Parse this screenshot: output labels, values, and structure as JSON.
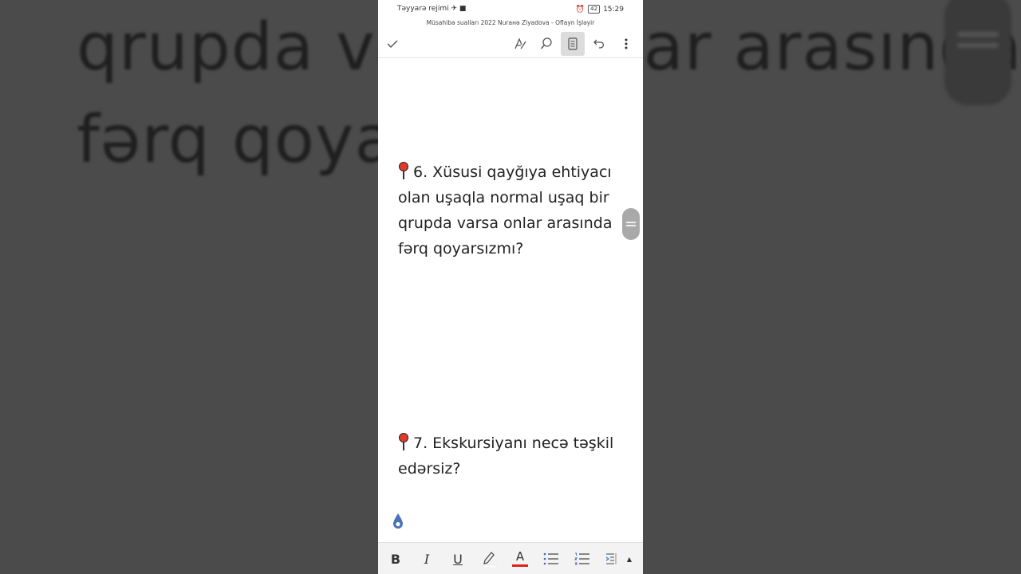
{
  "background": {
    "line1": "qrupda varsa onlar arasında",
    "line2": "fərq qoyarsızmı?"
  },
  "status_bar": {
    "left_text": "Təyyarə rejimi",
    "battery": "42",
    "time": "15:29"
  },
  "document": {
    "title": "Müsahibə sualları 2022 Nurанə Ziyadova - Oflayn İşləyir"
  },
  "toolbar": {
    "done_icon": "check-icon",
    "items": [
      "draw-icon",
      "search-icon",
      "mobile-view-icon",
      "undo-icon",
      "more-icon"
    ]
  },
  "content": {
    "question6": "6. Xüsusi qayğıya ehtiyacı olan uşaqla normal uşaq bir qrupda varsa onlar arasında fərq qoyarsızmı?",
    "question7": "7. Ekskursiyanı necə təşkil edərsiz?"
  },
  "format_bar": {
    "bold": "B",
    "italic": "I",
    "underline": "U",
    "font_color": "A",
    "highlight_color": "#ffffff",
    "text_color": "#e02020"
  }
}
